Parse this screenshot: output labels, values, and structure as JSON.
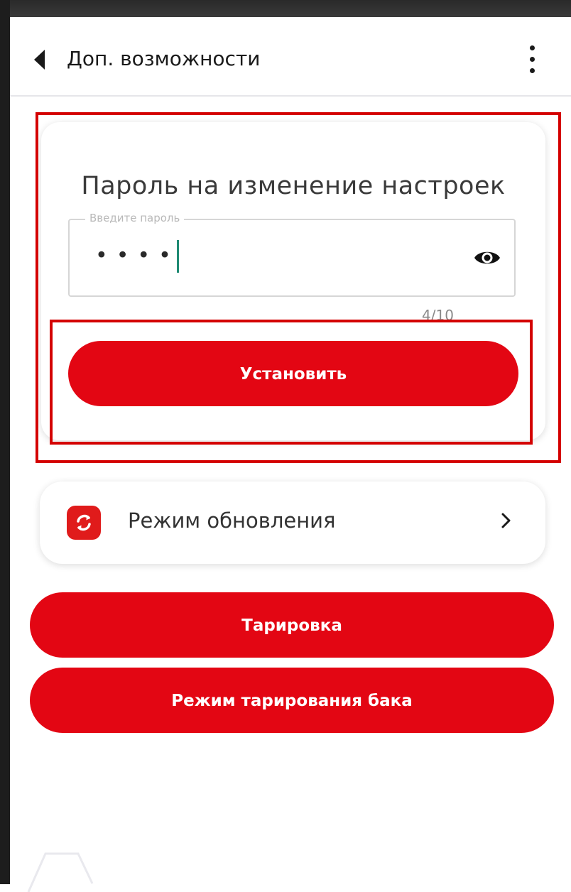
{
  "header": {
    "title": "Доп. возможности",
    "back_icon": "back-arrow-icon",
    "menu_icon": "more-vert-icon"
  },
  "password_card": {
    "title": "Пароль на изменение настроек",
    "field_label": "Введите пароль",
    "masked_value": "••••",
    "visibility_icon": "eye-icon",
    "counter": "4/10",
    "submit_label": "Установить"
  },
  "update_mode": {
    "label": "Режим обновления",
    "icon": "refresh-icon",
    "chevron_icon": "chevron-right-icon"
  },
  "actions": {
    "tare_label": "Тарировка",
    "tank_tare_label": "Режим тарирования бака"
  },
  "colors": {
    "accent": "#e30613",
    "highlight": "#d40000",
    "cursor": "#1f8a73"
  }
}
